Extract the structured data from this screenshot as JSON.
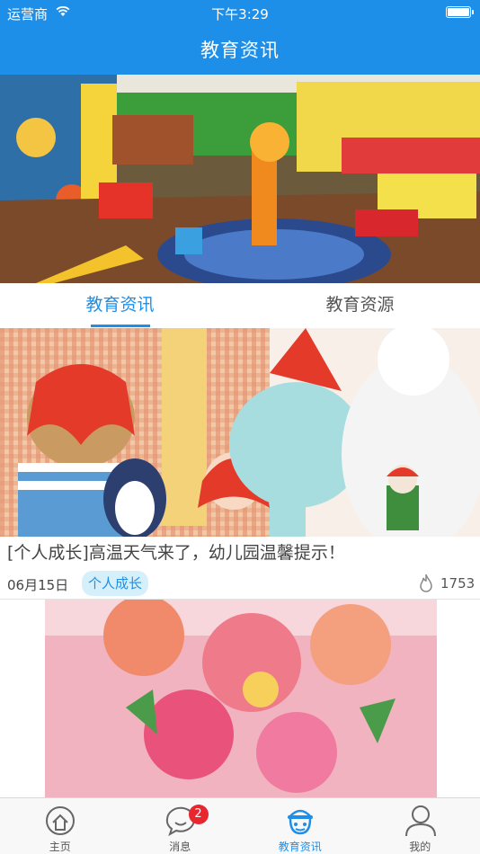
{
  "status_bar": {
    "carrier": "运营商",
    "time": "下午3:29"
  },
  "nav": {
    "title": "教育资讯"
  },
  "tabs": [
    {
      "label": "教育资讯",
      "active": true
    },
    {
      "label": "教育资源",
      "active": false
    }
  ],
  "articles": [
    {
      "title": "[个人成长]高温天气来了，幼儿园温馨提示！",
      "date": "06月15日",
      "tag": "个人成长",
      "views": "1753"
    }
  ],
  "tabbar": {
    "items": [
      {
        "label": "主页",
        "icon": "home-icon"
      },
      {
        "label": "消息",
        "icon": "chat-icon",
        "badge": "2"
      },
      {
        "label": "教育资讯",
        "icon": "education-icon",
        "active": true
      },
      {
        "label": "我的",
        "icon": "profile-icon"
      }
    ]
  },
  "colors": {
    "primary": "#1e8fe8",
    "badge": "#e8262d",
    "tag_bg": "#d6f0fb"
  }
}
